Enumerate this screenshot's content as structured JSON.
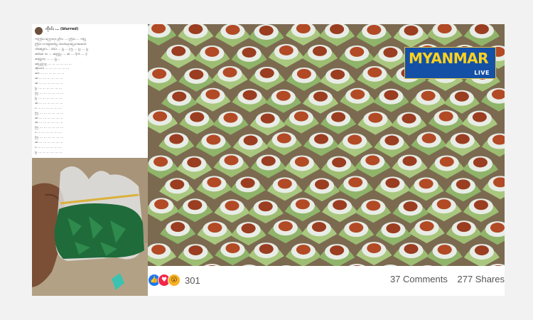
{
  "post": {
    "author": "ကိုဝင်း ... (blurred)",
    "time": "...",
    "lines": [
      "ကံကြိမ်း ကြောလုံး ညီလ ... ကြိမ်း ... ကံပြုံ",
      "ကြိမ်း လာထူးထင်ပြ ထဲပါးနောပြေးပါးဆောင်",
      "သိစေခြင်း... သိမ်း ... ပြ ... ကြ ... ပြ ... ပြ",
      "ဆံမိစေ သ ... ဆည့်ပြဲ ... ဆံ ... ပိုက် ... ပို",
      "ဆန်ပြတဲ့ ... ... ပြ...",
      "ဆပြည့်သူ ... ... ... ... ... ...",
      "ဆိုမာလဲ ... ... ... ... ... ...",
      "ဆာ ... ... ... ... ... ...",
      "ဆ ... ... ... ... ... ...",
      "ဆံ ... ... ... ... ... ...",
      "ပြ ... ... ... ... ... ...",
      "ကြ ... ... ... ... ... ...",
      "ပြ ... ... ... ... ... ...",
      "ဆ ... ... ... ... ... ...",
      "ပ ... ... ... ... ... ...",
      "ကြ ... ... ... ... ... ...",
      "ဆ ... ... ... ... ... ...",
      "ဆ ... ... ... ... ... ...",
      "ကြ ... ... ... ... ... ...",
      "ပ ... ... ... ... ... ...",
      "ကြ ... ... ... ... ... ...",
      "ဆ ... ... ... ... ... ...",
      "ပ ... ... ... ... ... ...",
      "ပြ ... ... ... ... ... ..."
    ]
  },
  "logo": {
    "title": "MYANMAR",
    "subtitle": "LIVE"
  },
  "reactions": {
    "icons": [
      "like-icon",
      "love-icon",
      "wow-icon"
    ],
    "count": "301"
  },
  "stats": {
    "comments": "37 Comments",
    "shares": "277 Shares"
  },
  "colors": {
    "logo_bg": "#1451a6",
    "logo_text": "#ffd21f",
    "like": "#1877f2",
    "love": "#f0284a",
    "wow": "#f7b125"
  }
}
